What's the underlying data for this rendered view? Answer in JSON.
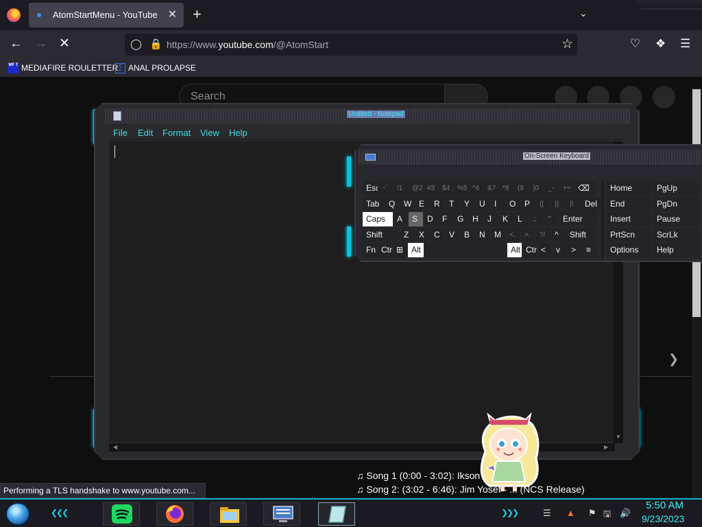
{
  "browser": {
    "tab_title": "AtomStartMenu - YouTube",
    "tab_close": "✕",
    "new_tab": "+",
    "tab_list_icon": "chevron-down-icon",
    "url_prefix": "https://www.",
    "url_domain": "youtube.com",
    "url_path": "/@AtomStart",
    "bookmarks": [
      {
        "label": "MEDIAFIRE ROULETTER",
        "icon": "mediafire-icon",
        "icon_text": "MF T"
      },
      {
        "label": "ANAL PROLAPSE",
        "icon": "bookmark-icon"
      }
    ],
    "status": "Performing a TLS handshake to www.youtube.com..."
  },
  "youtube": {
    "search_placeholder": "Search"
  },
  "notepad": {
    "title": "Untitled - Notepad",
    "menu": [
      "File",
      "Edit",
      "Format",
      "View",
      "Help"
    ],
    "content": ""
  },
  "osk": {
    "title": "On-Screen Keyboard",
    "caps_active": true,
    "alt_active": true,
    "hovered_key": "S",
    "rows": [
      [
        "Esc",
        "~`",
        "!1",
        "@2",
        "#3",
        "$4",
        "%5",
        "^6",
        "&7",
        "*8",
        "(9",
        ")0",
        "_-",
        "+=",
        "⌫"
      ],
      [
        "Tab",
        "Q",
        "W",
        "E",
        "R",
        "T",
        "Y",
        "U",
        "I",
        "O",
        "P",
        "{[",
        "}]",
        "|\\",
        "Del"
      ],
      [
        "Caps",
        "A",
        "S",
        "D",
        "F",
        "G",
        "H",
        "J",
        "K",
        "L",
        ":;",
        "\"'",
        "Enter"
      ],
      [
        "Shift",
        "Z",
        "X",
        "C",
        "V",
        "B",
        "N",
        "M",
        "<,",
        ">.",
        "?/",
        "^",
        "Shift"
      ],
      [
        "Fn",
        "Ctrl",
        "⊞",
        "Alt",
        "",
        "Alt",
        "Ctrl",
        "<",
        "v",
        ">",
        "≡"
      ]
    ],
    "nav_rows": [
      [
        "Home",
        "PgUp"
      ],
      [
        "End",
        "PgDn"
      ],
      [
        "Insert",
        "Pause"
      ],
      [
        "PrtScn",
        "ScrLk"
      ],
      [
        "Options",
        "Help"
      ]
    ]
  },
  "songs": [
    "♫ Song 1 (0:00 - 3:02): Ikson - ",
    "♫ Song 2: (3:02 - 6:46): Jim Yosef - ... (NCS Release)"
  ],
  "taskbar": {
    "apps": [
      "spotify-icon",
      "firefox-icon",
      "file-explorer-icon",
      "on-screen-keyboard-icon",
      "notepad-icon"
    ],
    "clock_time": "5:50 AM",
    "clock_date": "9/23/2023"
  },
  "colors": {
    "accent": "#3cf0f0",
    "glow": "#00c8e0",
    "spotify": "#1ed760"
  }
}
